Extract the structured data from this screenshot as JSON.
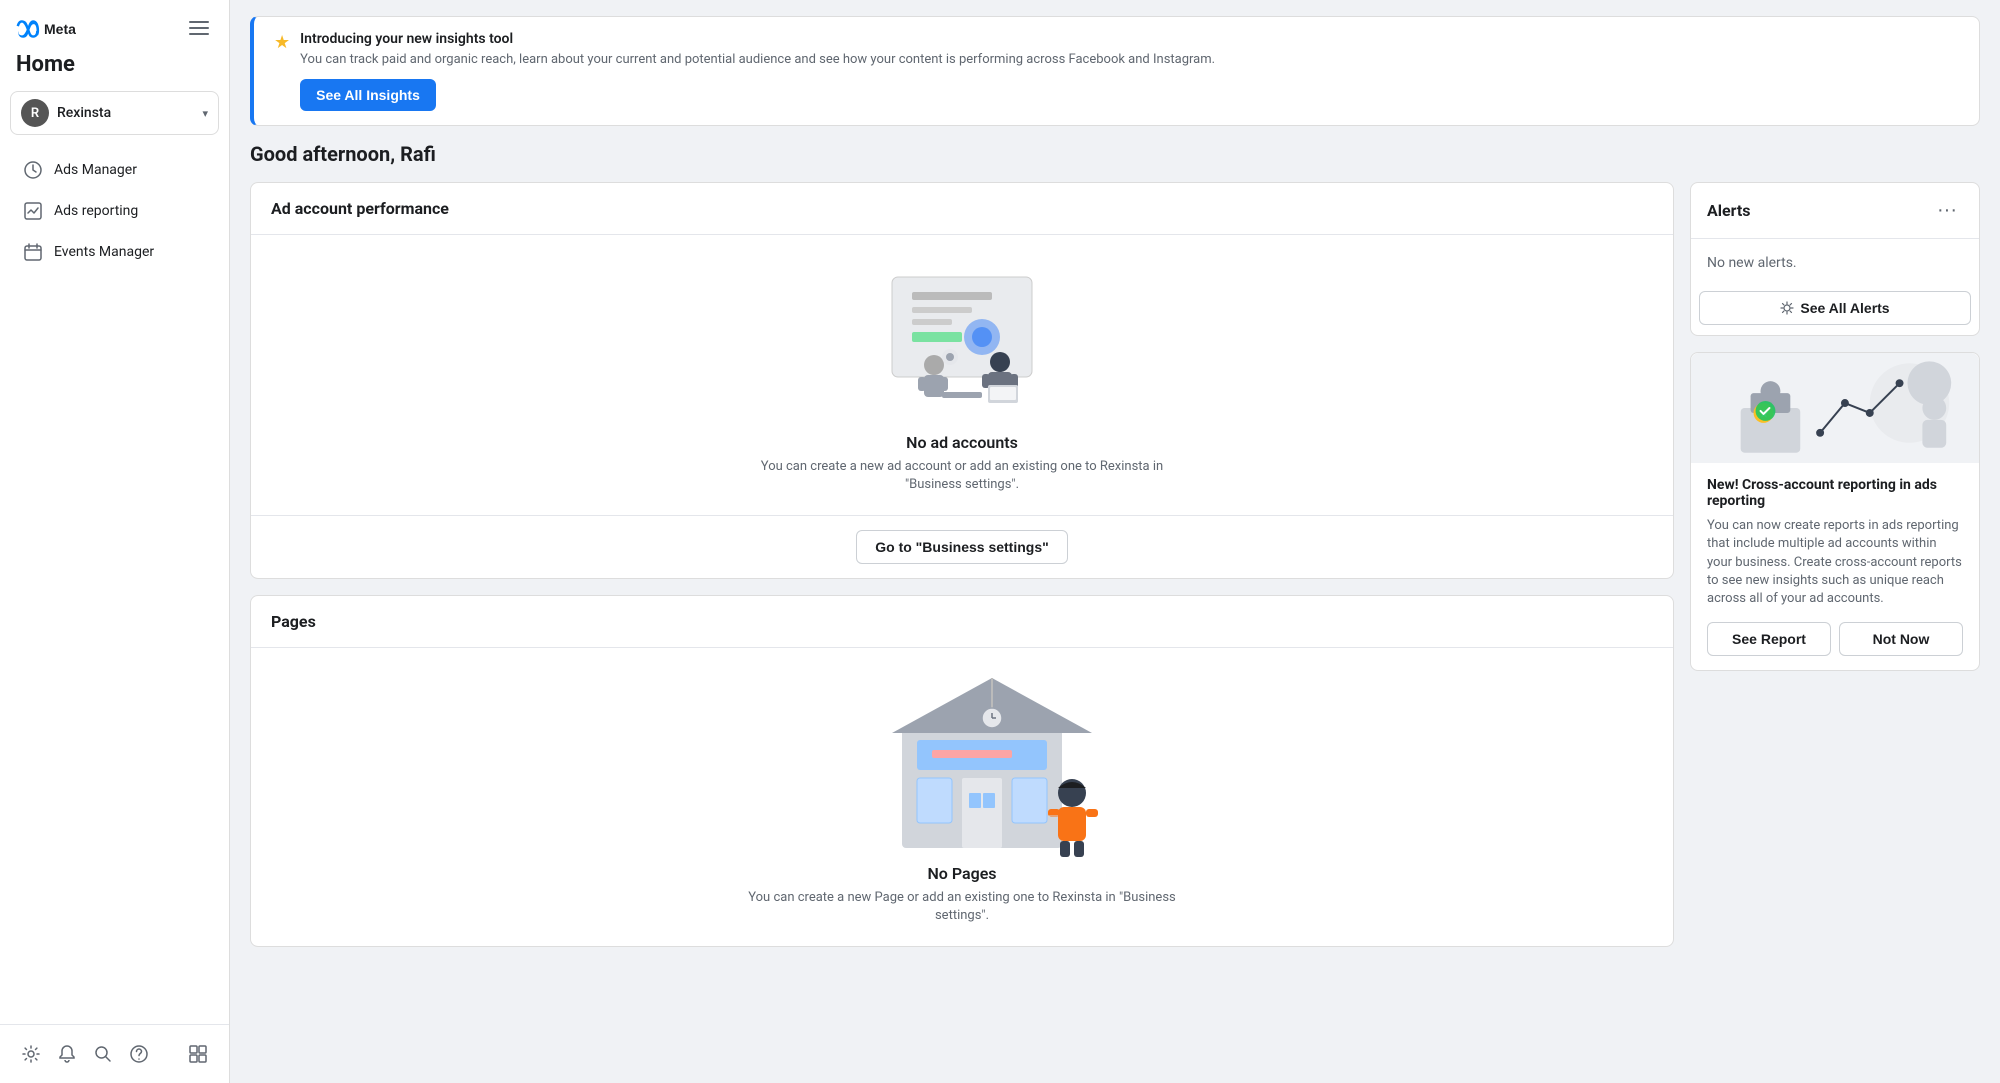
{
  "sidebar": {
    "logo_alt": "Meta logo",
    "home_title": "Home",
    "account": {
      "initial": "R",
      "name": "Rexinsta"
    },
    "nav_items": [
      {
        "id": "ads-manager",
        "label": "Ads Manager",
        "icon": "ads-manager-icon"
      },
      {
        "id": "ads-reporting",
        "label": "Ads reporting",
        "icon": "ads-reporting-icon"
      },
      {
        "id": "events-manager",
        "label": "Events Manager",
        "icon": "events-manager-icon"
      }
    ],
    "footer_icons": [
      "settings-icon",
      "bell-icon",
      "search-icon",
      "help-icon",
      "grid-icon"
    ]
  },
  "banner": {
    "title": "Introducing your new insights tool",
    "description": "You can track paid and organic reach, learn about your current and potential audience and see how your content is performing across Facebook and Instagram.",
    "cta_label": "See All Insights"
  },
  "greeting": "Good afternoon, Rafi",
  "ad_account_performance": {
    "card_title": "Ad account performance",
    "no_items_title": "No ad accounts",
    "no_items_desc": "You can create a new ad account or add an existing one to Rexinsta in \"Business settings\".",
    "cta_label": "Go to \"Business settings\""
  },
  "pages": {
    "card_title": "Pages",
    "no_items_title": "No Pages",
    "no_items_desc": "You can create a new Page or add an existing one to Rexinsta in \"Business settings\"."
  },
  "alerts": {
    "card_title": "Alerts",
    "no_alerts_text": "No new alerts.",
    "see_all_label": "See All Alerts"
  },
  "cross_account": {
    "title": "New! Cross-account reporting in ads reporting",
    "description": "You can now create reports in ads reporting that include multiple ad accounts within your business. Create cross-account reports to see new insights such as unique reach across all of your ad accounts.",
    "see_report_label": "See Report",
    "not_now_label": "Not Now"
  }
}
